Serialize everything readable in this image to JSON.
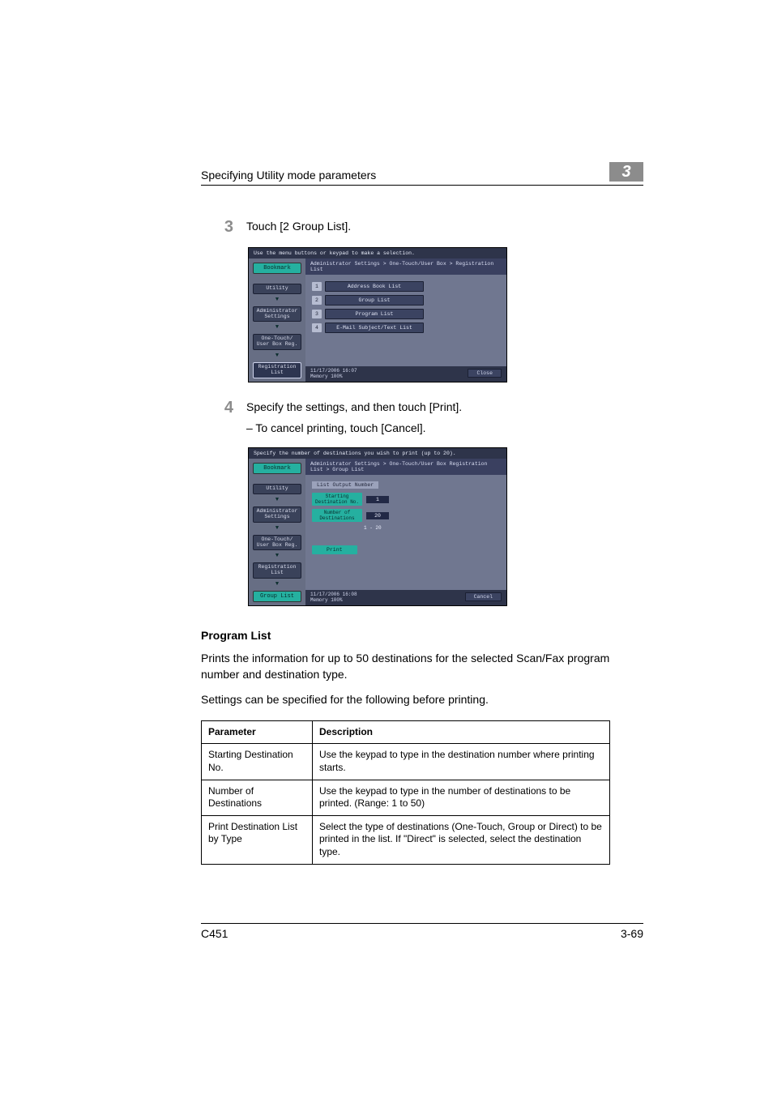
{
  "header": {
    "title": "Specifying Utility mode parameters",
    "chapter": "3"
  },
  "steps": {
    "s3": {
      "num": "3",
      "text": "Touch [2 Group List]."
    },
    "s4": {
      "num": "4",
      "text": "Specify the settings, and then touch [Print].",
      "sub": "–   To cancel printing, touch [Cancel]."
    }
  },
  "shot1": {
    "top": "Use the menu buttons or keypad to make a selection.",
    "crumb": "Administrator Settings > One-Touch/User Box > Registration List",
    "nav": {
      "bookmark": "Bookmark",
      "utility": "Utility",
      "admin": "Administrator Settings",
      "onetouch": "One-Touch/ User Box Reg.",
      "reglist": "Registration List"
    },
    "menu": {
      "i1n": "1",
      "i1": "Address Book List",
      "i2n": "2",
      "i2": "Group List",
      "i3n": "3",
      "i3": "Program List",
      "i4n": "4",
      "i4": "E-Mail Subject/Text List"
    },
    "foot": {
      "dt": "11/17/2006   16:07",
      "mem": "Memory        100%",
      "close": "Close"
    }
  },
  "shot2": {
    "top": "Specify the number of destinations you wish to print (up to 20).",
    "crumb": "Administrator Settings > One-Touch/User Box Registration List > Group List",
    "panel": "List Output Number",
    "nav": {
      "bookmark": "Bookmark",
      "utility": "Utility",
      "admin": "Administrator Settings",
      "onetouch": "One-Touch/ User Box Reg.",
      "reglist": "Registration List",
      "grouplist": "Group List"
    },
    "fields": {
      "startLbl": "Starting Destination No.",
      "startVal": "1",
      "numLbl": "Number of Destinations",
      "numVal": "20",
      "range": "1  -  20"
    },
    "print": "Print",
    "foot": {
      "dt": "11/17/2006   16:08",
      "mem": "Memory        100%",
      "cancel": "Cancel"
    }
  },
  "section": {
    "title": "Program List",
    "p1": "Prints the information for up to 50 destinations for the selected Scan/Fax program number and destination type.",
    "p2": "Settings can be specified for the following before printing."
  },
  "table": {
    "h1": "Parameter",
    "h2": "Description",
    "r1p": "Starting Destination No.",
    "r1d": "Use the keypad to type in the destination number where printing starts.",
    "r2p": "Number of Destinations",
    "r2d": "Use the keypad to type in the number of destinations to be printed. (Range: 1 to 50)",
    "r3p": "Print Destination List by Type",
    "r3d": "Select the type of destinations (One-Touch, Group or Direct) to be printed in the list. If \"Direct\" is selected, select the destination type."
  },
  "footer": {
    "model": "C451",
    "page": "3-69"
  }
}
